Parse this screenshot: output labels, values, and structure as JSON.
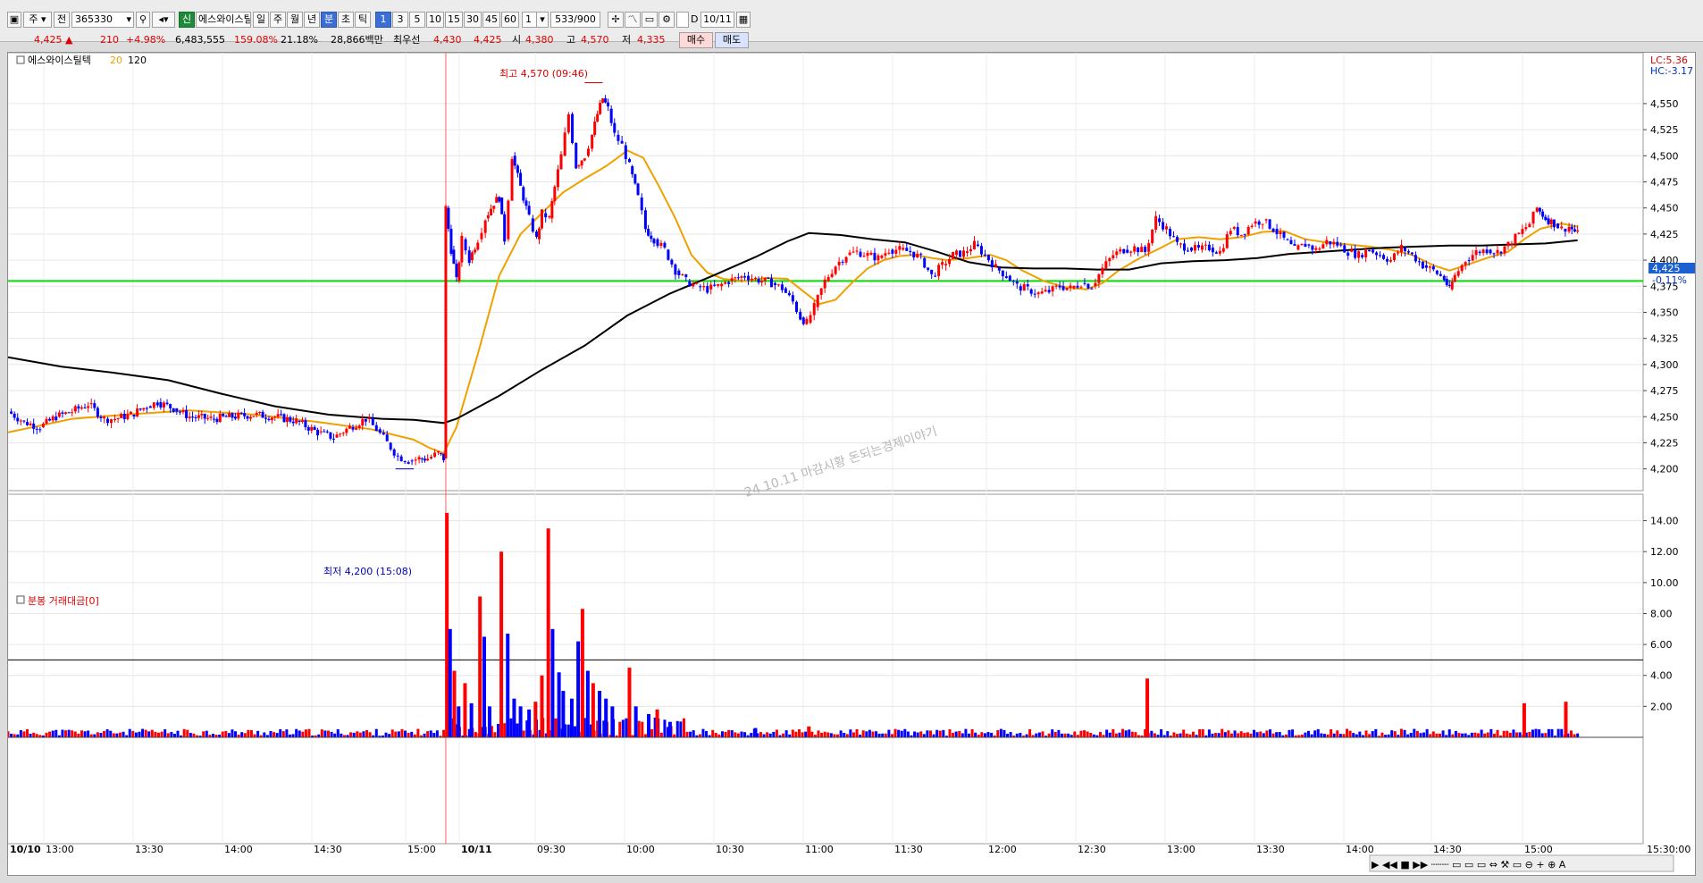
{
  "toolbar": {
    "type_select": "주",
    "jeon_label": "전",
    "code": "365330",
    "sin_badge": "신",
    "stock_name": "에스와이스틸",
    "periods": [
      "일",
      "주",
      "월",
      "년",
      "분",
      "초",
      "틱"
    ],
    "active_period": "분",
    "intervals": [
      "1",
      "3",
      "5",
      "10",
      "15",
      "30",
      "45",
      "60"
    ],
    "active_interval": "1",
    "count_value": "1",
    "bar_count": "533/900",
    "d_label": "D",
    "date_value": "10/11"
  },
  "quote": {
    "price": "4,425",
    "arrow": "▲",
    "change": "210",
    "change_pct": "+4.98%",
    "volume": "6,483,555",
    "vol_ratio": "159.08%",
    "turnover": "21.18%",
    "amount": "28,866백만",
    "best_ask_label": "최우선",
    "best_ask": "4,430",
    "best_bid": "4,425",
    "open_label": "시",
    "open": "4,380",
    "high_label": "고",
    "high": "4,570",
    "low_label": "저",
    "low": "4,335",
    "buy_button": "매수",
    "sell_button": "매도"
  },
  "price_panel": {
    "legend_name": "에스와이스틸텍",
    "legend_ma20": "20",
    "legend_ma120": "120",
    "lc_label": "LC:5.36",
    "hc_label": "HC:-3.17",
    "current_price": "4,425",
    "current_pct": "-0.11%",
    "high_annotation": "최고 4,570 (09:46)",
    "low_annotation": "최저 4,200 (15:08)",
    "watermark": "24.10.11 마감시황 돈되는경제이야기",
    "colors": {
      "up": "#ff0000",
      "down": "#0000ff",
      "ma20": "#f0a000",
      "ma120": "#000000",
      "hline": "#00e000"
    }
  },
  "volume_panel": {
    "legend": "분봉 거래대금[0]",
    "y_ticks": [
      "14.00",
      "12.00",
      "10.00",
      "8.00",
      "6.00",
      "4.00",
      "2.00"
    ]
  },
  "x_axis": {
    "labels": [
      "10/10",
      "13:00",
      "13:30",
      "14:00",
      "14:30",
      "15:00",
      "10/11",
      "09:30",
      "10:00",
      "10:30",
      "11:00",
      "11:30",
      "12:00",
      "12:30",
      "13:00",
      "13:30",
      "14:00",
      "14:30",
      "15:00"
    ],
    "end_label": "15:30:00"
  },
  "chart_data": [
    {
      "type": "candlestick",
      "y_ticks": [
        "4,550",
        "4,525",
        "4,500",
        "4,475",
        "4,450",
        "4,425",
        "4,400",
        "4,375",
        "4,350",
        "4,325",
        "4,300",
        "4,275",
        "4,250",
        "4,225",
        "4,200"
      ],
      "ylim": [
        4192,
        4585
      ],
      "reference_line": 4380,
      "close_path": [
        [
          0,
          4255
        ],
        [
          15,
          4245
        ],
        [
          30,
          4240
        ],
        [
          45,
          4250
        ],
        [
          60,
          4255
        ],
        [
          75,
          4262
        ],
        [
          90,
          4248
        ],
        [
          100,
          4248
        ],
        [
          115,
          4252
        ],
        [
          130,
          4260
        ],
        [
          140,
          4264
        ],
        [
          155,
          4258
        ],
        [
          170,
          4250
        ],
        [
          190,
          4248
        ],
        [
          210,
          4250
        ],
        [
          230,
          4252
        ],
        [
          250,
          4250
        ],
        [
          270,
          4246
        ],
        [
          290,
          4235
        ],
        [
          305,
          4230
        ],
        [
          320,
          4240
        ],
        [
          335,
          4248
        ],
        [
          345,
          4238
        ],
        [
          355,
          4225
        ],
        [
          365,
          4212
        ],
        [
          375,
          4208
        ],
        [
          385,
          4210
        ],
        [
          393,
          4210
        ],
        [
          403,
          4215
        ],
        [
          408,
          4210
        ],
        [
          410,
          4450
        ],
        [
          415,
          4410
        ],
        [
          420,
          4380
        ],
        [
          425,
          4420
        ],
        [
          432,
          4400
        ],
        [
          440,
          4420
        ],
        [
          447,
          4440
        ],
        [
          455,
          4455
        ],
        [
          460,
          4460
        ],
        [
          465,
          4420
        ],
        [
          472,
          4500
        ],
        [
          480,
          4470
        ],
        [
          488,
          4440
        ],
        [
          495,
          4420
        ],
        [
          500,
          4445
        ],
        [
          507,
          4440
        ],
        [
          512,
          4470
        ],
        [
          518,
          4500
        ],
        [
          525,
          4540
        ],
        [
          532,
          4490
        ],
        [
          540,
          4500
        ],
        [
          547,
          4520
        ],
        [
          552,
          4540
        ],
        [
          557,
          4555
        ],
        [
          562,
          4545
        ],
        [
          568,
          4520
        ],
        [
          575,
          4510
        ],
        [
          582,
          4490
        ],
        [
          590,
          4460
        ],
        [
          597,
          4430
        ],
        [
          605,
          4420
        ],
        [
          615,
          4410
        ],
        [
          625,
          4390
        ],
        [
          635,
          4380
        ],
        [
          645,
          4375
        ],
        [
          655,
          4372
        ],
        [
          665,
          4375
        ],
        [
          675,
          4380
        ],
        [
          690,
          4385
        ],
        [
          700,
          4382
        ],
        [
          715,
          4378
        ],
        [
          725,
          4373
        ],
        [
          735,
          4360
        ],
        [
          742,
          4345
        ],
        [
          748,
          4340
        ],
        [
          755,
          4355
        ],
        [
          765,
          4380
        ],
        [
          775,
          4395
        ],
        [
          785,
          4405
        ],
        [
          795,
          4408
        ],
        [
          805,
          4405
        ],
        [
          815,
          4402
        ],
        [
          825,
          4410
        ],
        [
          835,
          4410
        ],
        [
          845,
          4408
        ],
        [
          855,
          4402
        ],
        [
          865,
          4385
        ],
        [
          875,
          4395
        ],
        [
          885,
          4405
        ],
        [
          895,
          4407
        ],
        [
          905,
          4415
        ],
        [
          915,
          4405
        ],
        [
          925,
          4393
        ],
        [
          935,
          4385
        ],
        [
          945,
          4375
        ],
        [
          955,
          4372
        ],
        [
          965,
          4368
        ],
        [
          975,
          4370
        ],
        [
          985,
          4375
        ],
        [
          995,
          4373
        ],
        [
          1005,
          4378
        ],
        [
          1015,
          4375
        ],
        [
          1025,
          4392
        ],
        [
          1035,
          4405
        ],
        [
          1045,
          4410
        ],
        [
          1055,
          4412
        ],
        [
          1065,
          4408
        ],
        [
          1075,
          4440
        ],
        [
          1085,
          4430
        ],
        [
          1095,
          4415
        ],
        [
          1105,
          4412
        ],
        [
          1115,
          4410
        ],
        [
          1125,
          4412
        ],
        [
          1135,
          4408
        ],
        [
          1145,
          4430
        ],
        [
          1155,
          4425
        ],
        [
          1165,
          4435
        ],
        [
          1175,
          4438
        ],
        [
          1185,
          4430
        ],
        [
          1195,
          4420
        ],
        [
          1205,
          4410
        ],
        [
          1215,
          4415
        ],
        [
          1225,
          4410
        ],
        [
          1235,
          4418
        ],
        [
          1245,
          4415
        ],
        [
          1255,
          4408
        ],
        [
          1265,
          4405
        ],
        [
          1275,
          4410
        ],
        [
          1285,
          4405
        ],
        [
          1295,
          4400
        ],
        [
          1305,
          4412
        ],
        [
          1315,
          4405
        ],
        [
          1325,
          4395
        ],
        [
          1335,
          4390
        ],
        [
          1345,
          4382
        ],
        [
          1350,
          4372
        ],
        [
          1355,
          4385
        ],
        [
          1365,
          4400
        ],
        [
          1375,
          4408
        ],
        [
          1385,
          4410
        ],
        [
          1395,
          4408
        ],
        [
          1405,
          4415
        ],
        [
          1415,
          4425
        ],
        [
          1425,
          4435
        ],
        [
          1432,
          4450
        ],
        [
          1440,
          4440
        ],
        [
          1448,
          4435
        ],
        [
          1455,
          4430
        ],
        [
          1462,
          4432
        ],
        [
          1470,
          4425
        ]
      ],
      "ma20_path": [
        [
          0,
          4235
        ],
        [
          60,
          4248
        ],
        [
          110,
          4252
        ],
        [
          170,
          4256
        ],
        [
          230,
          4252
        ],
        [
          290,
          4245
        ],
        [
          340,
          4238
        ],
        [
          380,
          4228
        ],
        [
          395,
          4220
        ],
        [
          408,
          4215
        ],
        [
          420,
          4240
        ],
        [
          440,
          4310
        ],
        [
          460,
          4385
        ],
        [
          480,
          4425
        ],
        [
          500,
          4445
        ],
        [
          520,
          4465
        ],
        [
          540,
          4478
        ],
        [
          560,
          4490
        ],
        [
          580,
          4505
        ],
        [
          595,
          4498
        ],
        [
          610,
          4470
        ],
        [
          625,
          4440
        ],
        [
          640,
          4405
        ],
        [
          655,
          4388
        ],
        [
          670,
          4382
        ],
        [
          690,
          4380
        ],
        [
          710,
          4383
        ],
        [
          730,
          4382
        ],
        [
          745,
          4370
        ],
        [
          760,
          4358
        ],
        [
          775,
          4362
        ],
        [
          790,
          4378
        ],
        [
          805,
          4392
        ],
        [
          820,
          4400
        ],
        [
          835,
          4404
        ],
        [
          850,
          4405
        ],
        [
          865,
          4402
        ],
        [
          880,
          4400
        ],
        [
          900,
          4402
        ],
        [
          920,
          4405
        ],
        [
          935,
          4400
        ],
        [
          950,
          4390
        ],
        [
          970,
          4380
        ],
        [
          990,
          4374
        ],
        [
          1010,
          4372
        ],
        [
          1025,
          4378
        ],
        [
          1040,
          4390
        ],
        [
          1060,
          4402
        ],
        [
          1080,
          4412
        ],
        [
          1095,
          4420
        ],
        [
          1115,
          4422
        ],
        [
          1135,
          4420
        ],
        [
          1155,
          4422
        ],
        [
          1175,
          4427
        ],
        [
          1195,
          4428
        ],
        [
          1215,
          4420
        ],
        [
          1235,
          4417
        ],
        [
          1255,
          4415
        ],
        [
          1275,
          4413
        ],
        [
          1295,
          4410
        ],
        [
          1315,
          4405
        ],
        [
          1335,
          4395
        ],
        [
          1350,
          4390
        ],
        [
          1365,
          4395
        ],
        [
          1385,
          4402
        ],
        [
          1405,
          4408
        ],
        [
          1420,
          4420
        ],
        [
          1435,
          4430
        ],
        [
          1455,
          4435
        ],
        [
          1470,
          4432
        ]
      ],
      "ma120_path": [
        [
          0,
          4307
        ],
        [
          50,
          4298
        ],
        [
          100,
          4292
        ],
        [
          150,
          4285
        ],
        [
          200,
          4272
        ],
        [
          250,
          4260
        ],
        [
          300,
          4252
        ],
        [
          350,
          4248
        ],
        [
          380,
          4247
        ],
        [
          408,
          4244
        ],
        [
          420,
          4248
        ],
        [
          460,
          4270
        ],
        [
          500,
          4295
        ],
        [
          540,
          4318
        ],
        [
          580,
          4347
        ],
        [
          620,
          4368
        ],
        [
          660,
          4385
        ],
        [
          700,
          4403
        ],
        [
          730,
          4418
        ],
        [
          750,
          4426
        ],
        [
          780,
          4424
        ],
        [
          810,
          4420
        ],
        [
          840,
          4417
        ],
        [
          870,
          4408
        ],
        [
          900,
          4398
        ],
        [
          930,
          4393
        ],
        [
          960,
          4392
        ],
        [
          990,
          4392
        ],
        [
          1020,
          4391
        ],
        [
          1050,
          4391
        ],
        [
          1080,
          4397
        ],
        [
          1110,
          4399
        ],
        [
          1140,
          4400
        ],
        [
          1170,
          4402
        ],
        [
          1200,
          4406
        ],
        [
          1230,
          4408
        ],
        [
          1260,
          4410
        ],
        [
          1290,
          4412
        ],
        [
          1320,
          4413
        ],
        [
          1350,
          4414
        ],
        [
          1380,
          4414
        ],
        [
          1410,
          4415
        ],
        [
          1440,
          4416
        ],
        [
          1470,
          4419
        ]
      ]
    },
    {
      "type": "bar",
      "y_ticks": [
        14,
        12,
        10,
        8,
        6,
        4,
        2
      ],
      "ylim": [
        0,
        14.9
      ],
      "reference_line": 5,
      "spikes": [
        [
          411,
          14.5,
          "up"
        ],
        [
          414,
          7.0,
          "down"
        ],
        [
          418,
          4.3,
          "up"
        ],
        [
          422,
          2.0,
          "down"
        ],
        [
          428,
          3.5,
          "up"
        ],
        [
          434,
          2.2,
          "down"
        ],
        [
          442,
          9.1,
          "up"
        ],
        [
          446,
          6.5,
          "down"
        ],
        [
          451,
          2.0,
          "down"
        ],
        [
          462,
          12.0,
          "up"
        ],
        [
          468,
          6.7,
          "down"
        ],
        [
          474,
          2.5,
          "down"
        ],
        [
          480,
          2.0,
          "down"
        ],
        [
          488,
          1.8,
          "down"
        ],
        [
          494,
          2.3,
          "up"
        ],
        [
          500,
          4.0,
          "up"
        ],
        [
          506,
          13.5,
          "up"
        ],
        [
          510,
          7.0,
          "down"
        ],
        [
          516,
          4.2,
          "down"
        ],
        [
          520,
          3.0,
          "down"
        ],
        [
          528,
          2.5,
          "down"
        ],
        [
          534,
          6.2,
          "down"
        ],
        [
          538,
          8.3,
          "up"
        ],
        [
          543,
          4.3,
          "down"
        ],
        [
          548,
          3.5,
          "up"
        ],
        [
          554,
          3.0,
          "down"
        ],
        [
          560,
          2.5,
          "down"
        ],
        [
          566,
          2.0,
          "down"
        ],
        [
          582,
          4.5,
          "up"
        ],
        [
          588,
          2.0,
          "down"
        ],
        [
          600,
          1.5,
          "down"
        ],
        [
          608,
          1.8,
          "up"
        ],
        [
          620,
          1.0,
          "down"
        ],
        [
          700,
          0.6,
          "down"
        ],
        [
          750,
          0.7,
          "up"
        ],
        [
          1067,
          3.8,
          "up"
        ],
        [
          1420,
          2.2,
          "up"
        ],
        [
          1459,
          2.3,
          "up"
        ]
      ]
    }
  ]
}
